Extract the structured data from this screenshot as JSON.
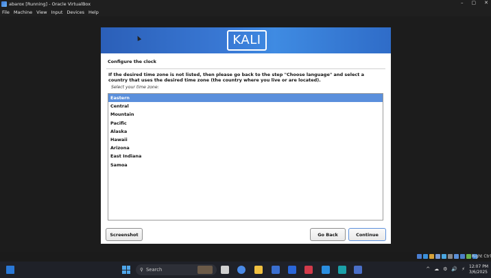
{
  "window": {
    "title": "abarox [Running] - Oracle VirtualBox",
    "controls": [
      "–",
      "▢",
      "✕"
    ]
  },
  "menu": [
    "File",
    "Machine",
    "View",
    "Input",
    "Devices",
    "Help"
  ],
  "installer": {
    "logo_text": "KALI",
    "page_title": "Configure the clock",
    "description": "If the desired time zone is not listed, then please go back to the step \"Choose language\" and select a country that uses the desired time zone (the country where you live or are located).",
    "prompt": "Select your time zone:",
    "timezones": [
      "Eastern",
      "Central",
      "Mountain",
      "Pacific",
      "Alaska",
      "Hawaii",
      "Arizona",
      "East Indiana",
      "Samoa"
    ],
    "selected_index": 0,
    "buttons": {
      "screenshot": "Screenshot",
      "go_back": "Go Back",
      "continue": "Continue"
    }
  },
  "vbox_status": {
    "right_ctrl": "Right Ctrl"
  },
  "taskbar": {
    "search_placeholder": "Search",
    "tray": [
      "^",
      "☁",
      "⚙",
      "🔊",
      "⚡"
    ],
    "time": "12:07 PM",
    "date": "3/6/2025"
  },
  "colors": {
    "accent": "#5a8fdc",
    "banner": "#3a7ad6"
  }
}
